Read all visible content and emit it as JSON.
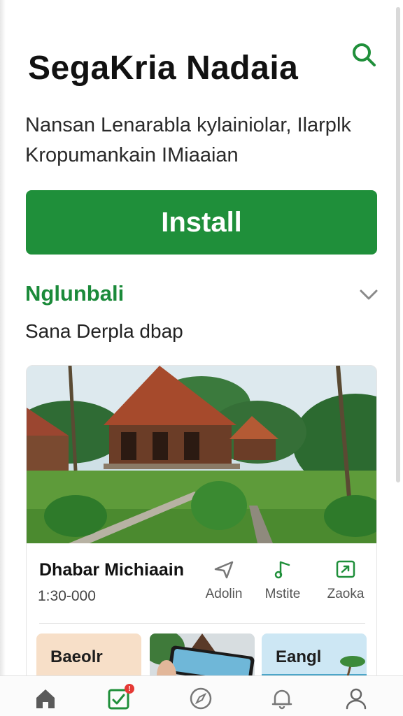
{
  "header": {
    "title": "SegaKria Nadaia",
    "subtitle_line1": "Nansan Lenarabla kylainiolar, Ilarplk",
    "subtitle_line2": "Kropumankain IMiaaian",
    "search_icon": "search-icon"
  },
  "install": {
    "label": "Install",
    "color": "#1f8f3a"
  },
  "section": {
    "title": "Nglunbali",
    "subtitle": "Sana Derpla dbap",
    "toggle_icon": "chevron-down-icon"
  },
  "card": {
    "title": "Dhabar Michiaain",
    "meta": "1:30-000",
    "actions": [
      {
        "label": "Adolin",
        "icon": "send-icon"
      },
      {
        "label": "Mstite",
        "icon": "music-note-icon"
      },
      {
        "label": "Zaoka",
        "icon": "share-box-icon"
      }
    ],
    "tiles": [
      {
        "label": "Baeolr"
      },
      {
        "label": ""
      },
      {
        "label": "Eangl"
      }
    ]
  },
  "bottom_nav": {
    "items": [
      {
        "icon": "home-icon"
      },
      {
        "icon": "checklist-icon",
        "badge": "!"
      },
      {
        "icon": "compass-icon"
      },
      {
        "icon": "bell-icon"
      },
      {
        "icon": "profile-icon"
      }
    ]
  },
  "colors": {
    "accent": "#1f8f3a",
    "badge": "#e53935"
  }
}
